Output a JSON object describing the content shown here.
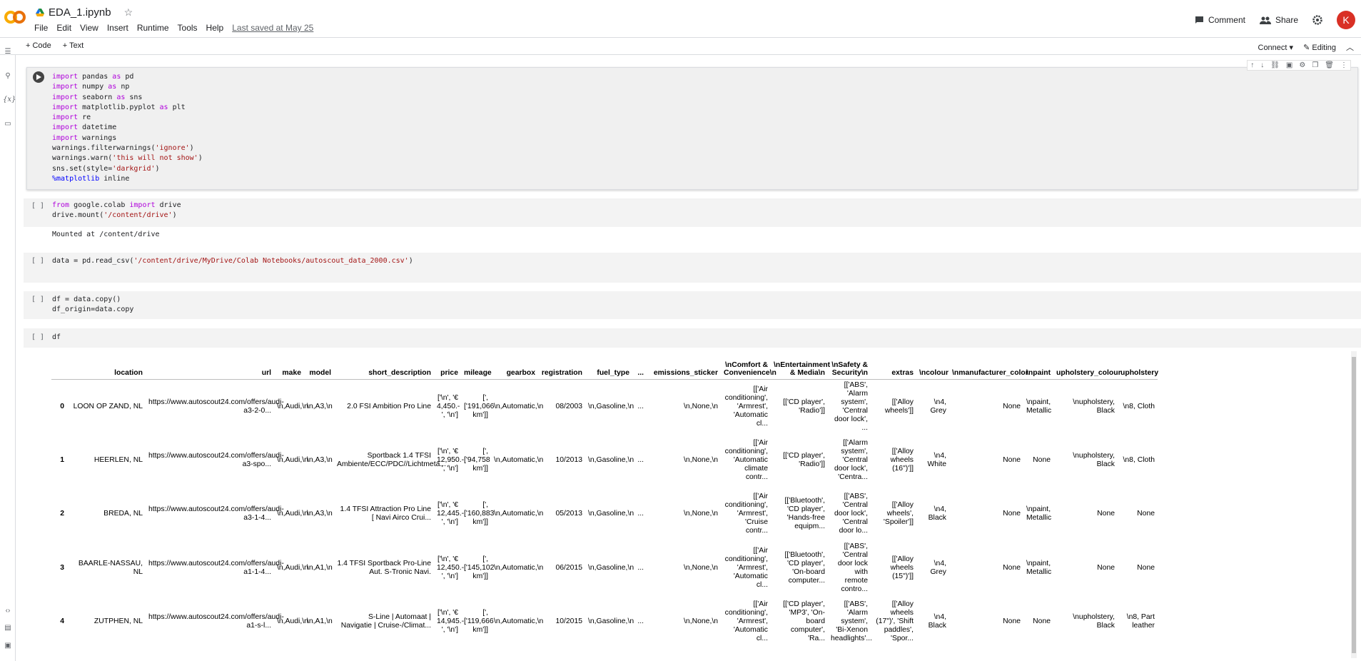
{
  "header": {
    "notebook_title": "EDA_1.ipynb",
    "menu": [
      "File",
      "Edit",
      "View",
      "Insert",
      "Runtime",
      "Tools",
      "Help"
    ],
    "last_saved": "Last saved at May 25",
    "comment_label": "Comment",
    "share_label": "Share",
    "avatar_letter": "K"
  },
  "toolbar": {
    "add_code": "+ Code",
    "add_text": "+ Text",
    "connect": "Connect",
    "editing": "Editing"
  },
  "cells": {
    "c1_lines": [
      [
        [
          "kw",
          "import"
        ],
        [
          "t",
          " pandas "
        ],
        [
          "kw",
          "as"
        ],
        [
          "t",
          " pd"
        ]
      ],
      [
        [
          "kw",
          "import"
        ],
        [
          "t",
          " numpy "
        ],
        [
          "kw",
          "as"
        ],
        [
          "t",
          " np"
        ]
      ],
      [
        [
          "kw",
          "import"
        ],
        [
          "t",
          " seaborn "
        ],
        [
          "kw",
          "as"
        ],
        [
          "t",
          " sns"
        ]
      ],
      [
        [
          "kw",
          "import"
        ],
        [
          "t",
          " matplotlib.pyplot "
        ],
        [
          "kw",
          "as"
        ],
        [
          "t",
          " plt"
        ]
      ],
      [
        [
          "kw",
          "import"
        ],
        [
          "t",
          " re"
        ]
      ],
      [
        [
          "kw",
          "import"
        ],
        [
          "t",
          " datetime"
        ]
      ],
      [
        [
          "kw",
          "import"
        ],
        [
          "t",
          " warnings"
        ]
      ],
      [
        [
          "t",
          "warnings.filterwarnings("
        ],
        [
          "str",
          "'ignore'"
        ],
        [
          "t",
          ")"
        ]
      ],
      [
        [
          "t",
          "warnings.warn("
        ],
        [
          "str",
          "'this will not show'"
        ],
        [
          "t",
          ")"
        ]
      ],
      [
        [
          "t",
          "sns.set(style="
        ],
        [
          "str",
          "'darkgrid'"
        ],
        [
          "t",
          ")"
        ]
      ],
      [
        [
          "mag",
          "%matplotlib"
        ],
        [
          "t",
          " inline"
        ]
      ]
    ],
    "c2_lines": [
      [
        [
          "kw",
          "from"
        ],
        [
          "t",
          " google.colab "
        ],
        [
          "kw",
          "import"
        ],
        [
          "t",
          " drive"
        ]
      ],
      [
        [
          "t",
          "drive.mount("
        ],
        [
          "str",
          "'/content/drive'"
        ],
        [
          "t",
          ")"
        ]
      ]
    ],
    "c2_output": "Mounted at /content/drive",
    "c3_lines": [
      [
        [
          "t",
          "data = pd.read_csv("
        ],
        [
          "str",
          "'/content/drive/MyDrive/Colab Notebooks/autoscout_data_2000.csv'"
        ],
        [
          "t",
          ")"
        ]
      ]
    ],
    "c4_lines": [
      [
        [
          "t",
          "df = data.copy()"
        ]
      ],
      [
        [
          "t",
          "df_origin=data.copy"
        ]
      ]
    ],
    "c5_lines": [
      [
        [
          "t",
          "df"
        ]
      ]
    ],
    "run_marker": "[ ]"
  },
  "table": {
    "columns": [
      "",
      "location",
      "url",
      "make",
      "model",
      "short_description",
      "price",
      "mileage",
      "gearbox",
      "registration",
      "fuel_type",
      "...",
      "emissions_sticker",
      "\\nComfort & Convenience\\n",
      "\\nEntertainment & Media\\n",
      "\\nSafety & Security\\n",
      "extras",
      "\\ncolour",
      "\\nmanufacturer_color",
      "\\npaint",
      "upholstery_colour",
      "upholstery"
    ],
    "rows": [
      [
        "0",
        "LOON OP ZAND, NL",
        "https://www.autoscout24.com/offers/audi-a3-2-0...",
        "\\n,Audi,\\n",
        "\\n,A3,\\n",
        "2.0 FSI Ambition Pro Line",
        "['\\n', '€ 4,450.-', '\\n']",
        "[', ['191,066 km']]",
        "\\n,Automatic,\\n",
        "08/2003",
        "\\n,Gasoline,\\n",
        "...",
        "\\n,None,\\n",
        "[['Air conditioning', 'Armrest', 'Automatic cl...",
        "[['CD player', 'Radio']]",
        "[['ABS', 'Alarm system', 'Central door lock', ...",
        "[['Alloy wheels']]",
        "\\n4, Grey",
        "None",
        "\\npaint, Metallic",
        "\\nupholstery, Black",
        "\\n8, Cloth"
      ],
      [
        "1",
        "HEERLEN, NL",
        "https://www.autoscout24.com/offers/audi-a3-spo...",
        "\\n,Audi,\\n",
        "\\n,A3,\\n",
        "Sportback 1.4 TFSI Ambiente/ECC/PDC//Lichtmeta...",
        "['\\n', '€ 12,950.-', '\\n']",
        "[', ['94,758 km']]",
        "\\n,Automatic,\\n",
        "10/2013",
        "\\n,Gasoline,\\n",
        "...",
        "\\n,None,\\n",
        "[['Air conditioning', 'Automatic climate contr...",
        "[['CD player', 'Radio']]",
        "[['Alarm system', 'Central door lock', 'Centra...",
        "[['Alloy wheels (16\")']]",
        "\\n4, White",
        "None",
        "None",
        "\\nupholstery, Black",
        "\\n8, Cloth"
      ],
      [
        "2",
        "BREDA, NL",
        "https://www.autoscout24.com/offers/audi-a3-1-4...",
        "\\n,Audi,\\n",
        "\\n,A3,\\n",
        "1.4 TFSI Attraction Pro Line [ Navi Airco Crui...",
        "['\\n', '€ 12,445.-', '\\n']",
        "[', ['160,883 km']]",
        "\\n,Automatic,\\n",
        "05/2013",
        "\\n,Gasoline,\\n",
        "...",
        "\\n,None,\\n",
        "[['Air conditioning', 'Armrest', 'Cruise contr...",
        "[['Bluetooth', 'CD player', 'Hands-free equipm...",
        "[['ABS', 'Central door lock', 'Central door lo...",
        "[['Alloy wheels', 'Spoiler']]",
        "\\n4, Black",
        "None",
        "\\npaint, Metallic",
        "None",
        "None"
      ],
      [
        "3",
        "BAARLE-NASSAU, NL",
        "https://www.autoscout24.com/offers/audi-a1-1-4...",
        "\\n,Audi,\\n",
        "\\n,A1,\\n",
        "1.4 TFSI Sportback Pro-Line Aut. S-Tronic Navi.",
        "['\\n', '€ 12,450.-', '\\n']",
        "[', ['145,102 km']]",
        "\\n,Automatic,\\n",
        "06/2015",
        "\\n,Gasoline,\\n",
        "...",
        "\\n,None,\\n",
        "[['Air conditioning', 'Armrest', 'Automatic cl...",
        "[['Bluetooth', 'CD player', 'On-board computer...",
        "[['ABS', 'Central door lock with remote contro...",
        "[['Alloy wheels (15\")']]",
        "\\n4, Grey",
        "None",
        "\\npaint, Metallic",
        "None",
        "None"
      ],
      [
        "4",
        "ZUTPHEN, NL",
        "https://www.autoscout24.com/offers/audi-a1-s-l...",
        "\\n,Audi,\\n",
        "\\n,A1,\\n",
        "S-Line | Automaat | Navigatie | Cruise-/Climat...",
        "['\\n', '€ 14,945.-', '\\n']",
        "[', ['119,666 km']]",
        "\\n,Automatic,\\n",
        "10/2015",
        "\\n,Gasoline,\\n",
        "...",
        "\\n,None,\\n",
        "[['Air conditioning', 'Armrest', 'Automatic cl...",
        "[['CD player', 'MP3', 'On-board computer', 'Ra...",
        "[['ABS', 'Alarm system', 'Bi-Xenon headlights'...",
        "[['Alloy wheels (17\")', 'Shift paddles', 'Spor...",
        "\\n4, Black",
        "None",
        "None",
        "\\nupholstery, Black",
        "\\n8, Part leather"
      ]
    ]
  },
  "colors": {
    "accent": "#f9ab00",
    "logo_orange": "#e8710a",
    "avatar": "#d93025"
  }
}
